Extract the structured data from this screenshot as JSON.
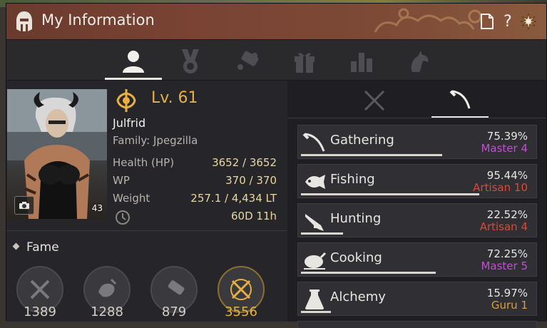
{
  "window": {
    "title": "My Information"
  },
  "tabs": [
    {
      "icon": "profile-icon"
    },
    {
      "icon": "medal-icon"
    },
    {
      "icon": "scroll-icon"
    },
    {
      "icon": "gift-icon"
    },
    {
      "icon": "stats-icon"
    },
    {
      "icon": "horse-icon"
    }
  ],
  "character": {
    "level": "Lv. 61",
    "name": "Julfrid",
    "family": "Family: Jpegzilla",
    "portrait_number": "43",
    "stats": [
      {
        "label": "Health (HP)",
        "value": "3652 / 3652"
      },
      {
        "label": "WP",
        "value": "370 / 370"
      },
      {
        "label": "Weight",
        "value": "257.1 / 4,434 LT"
      }
    ],
    "playtime": "60D 11h"
  },
  "fame": {
    "title": "Fame",
    "items": [
      {
        "icon": "combat-icon",
        "value": "1389"
      },
      {
        "icon": "lifeskill-icon",
        "value": "1288"
      },
      {
        "icon": "scroll-icon",
        "value": "879"
      },
      {
        "icon": "total-fame-icon",
        "value": "3556"
      }
    ]
  },
  "right_tabs": [
    {
      "icon": "crossed-swords-icon"
    },
    {
      "icon": "sickle-icon"
    }
  ],
  "skills": [
    {
      "name": "Gathering",
      "percent": "75.39%",
      "rank": "Master 4",
      "rank_color": "#c050d0",
      "progress": 0.7539
    },
    {
      "name": "Fishing",
      "percent": "95.44%",
      "rank": "Artisan 10",
      "rank_color": "#d84a3a",
      "progress": 0.9544
    },
    {
      "name": "Hunting",
      "percent": "22.52%",
      "rank": "Artisan 4",
      "rank_color": "#d84a3a",
      "progress": 0.2252
    },
    {
      "name": "Cooking",
      "percent": "72.25%",
      "rank": "Master 5",
      "rank_color": "#c050d0",
      "progress": 0.7225
    },
    {
      "name": "Alchemy",
      "percent": "15.97%",
      "rank": "Guru 1",
      "rank_color": "#d8a040",
      "progress": 0.1597
    }
  ]
}
